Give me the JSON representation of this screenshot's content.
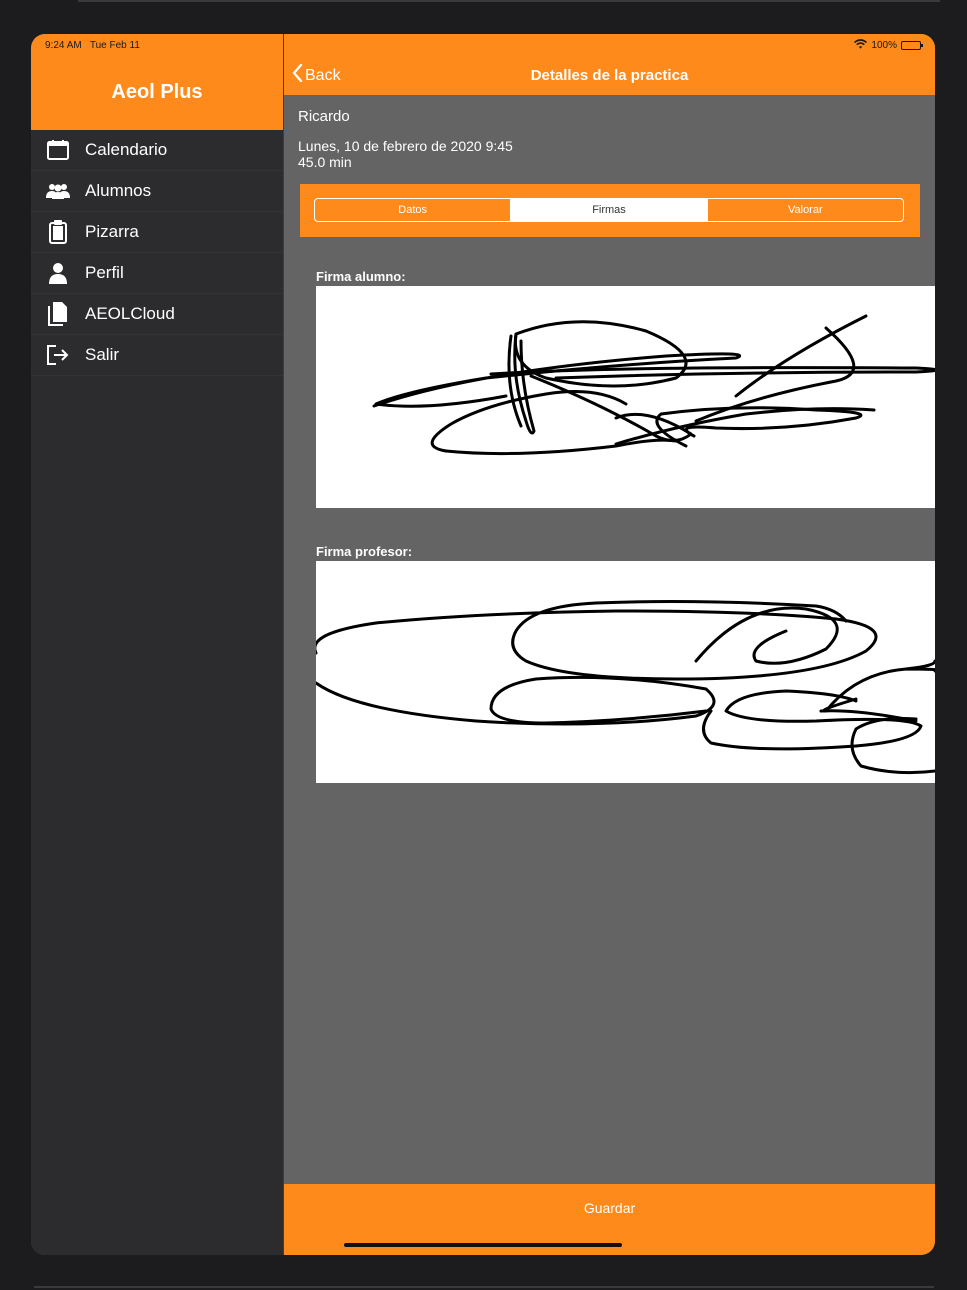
{
  "status_bar": {
    "time": "9:24 AM",
    "date": "Tue Feb 11",
    "battery": "100%"
  },
  "sidebar": {
    "title": "Aeol Plus",
    "items": [
      {
        "label": "Calendario",
        "icon": "calendar-icon"
      },
      {
        "label": "Alumnos",
        "icon": "users-icon"
      },
      {
        "label": "Pizarra",
        "icon": "clipboard-icon"
      },
      {
        "label": "Perfil",
        "icon": "person-icon"
      },
      {
        "label": "AEOLCloud",
        "icon": "documents-icon"
      },
      {
        "label": "Salir",
        "icon": "logout-icon"
      }
    ]
  },
  "navbar": {
    "back_label": "Back",
    "title": "Detalles de la practica"
  },
  "detail": {
    "student": "Ricardo",
    "datetime": "Lunes, 10 de febrero de 2020 9:45",
    "duration": "45.0 min",
    "tabs": [
      {
        "label": "Datos",
        "selected": false
      },
      {
        "label": "Firmas",
        "selected": true
      },
      {
        "label": "Valorar",
        "selected": false
      }
    ],
    "student_signature_label": "Firma alumno:",
    "teacher_signature_label": "Firma profesor:",
    "save_label": "Guardar"
  },
  "colors": {
    "accent": "#fe8a1b",
    "sidebar_bg": "#2c2c2e",
    "content_bg": "#646464"
  }
}
